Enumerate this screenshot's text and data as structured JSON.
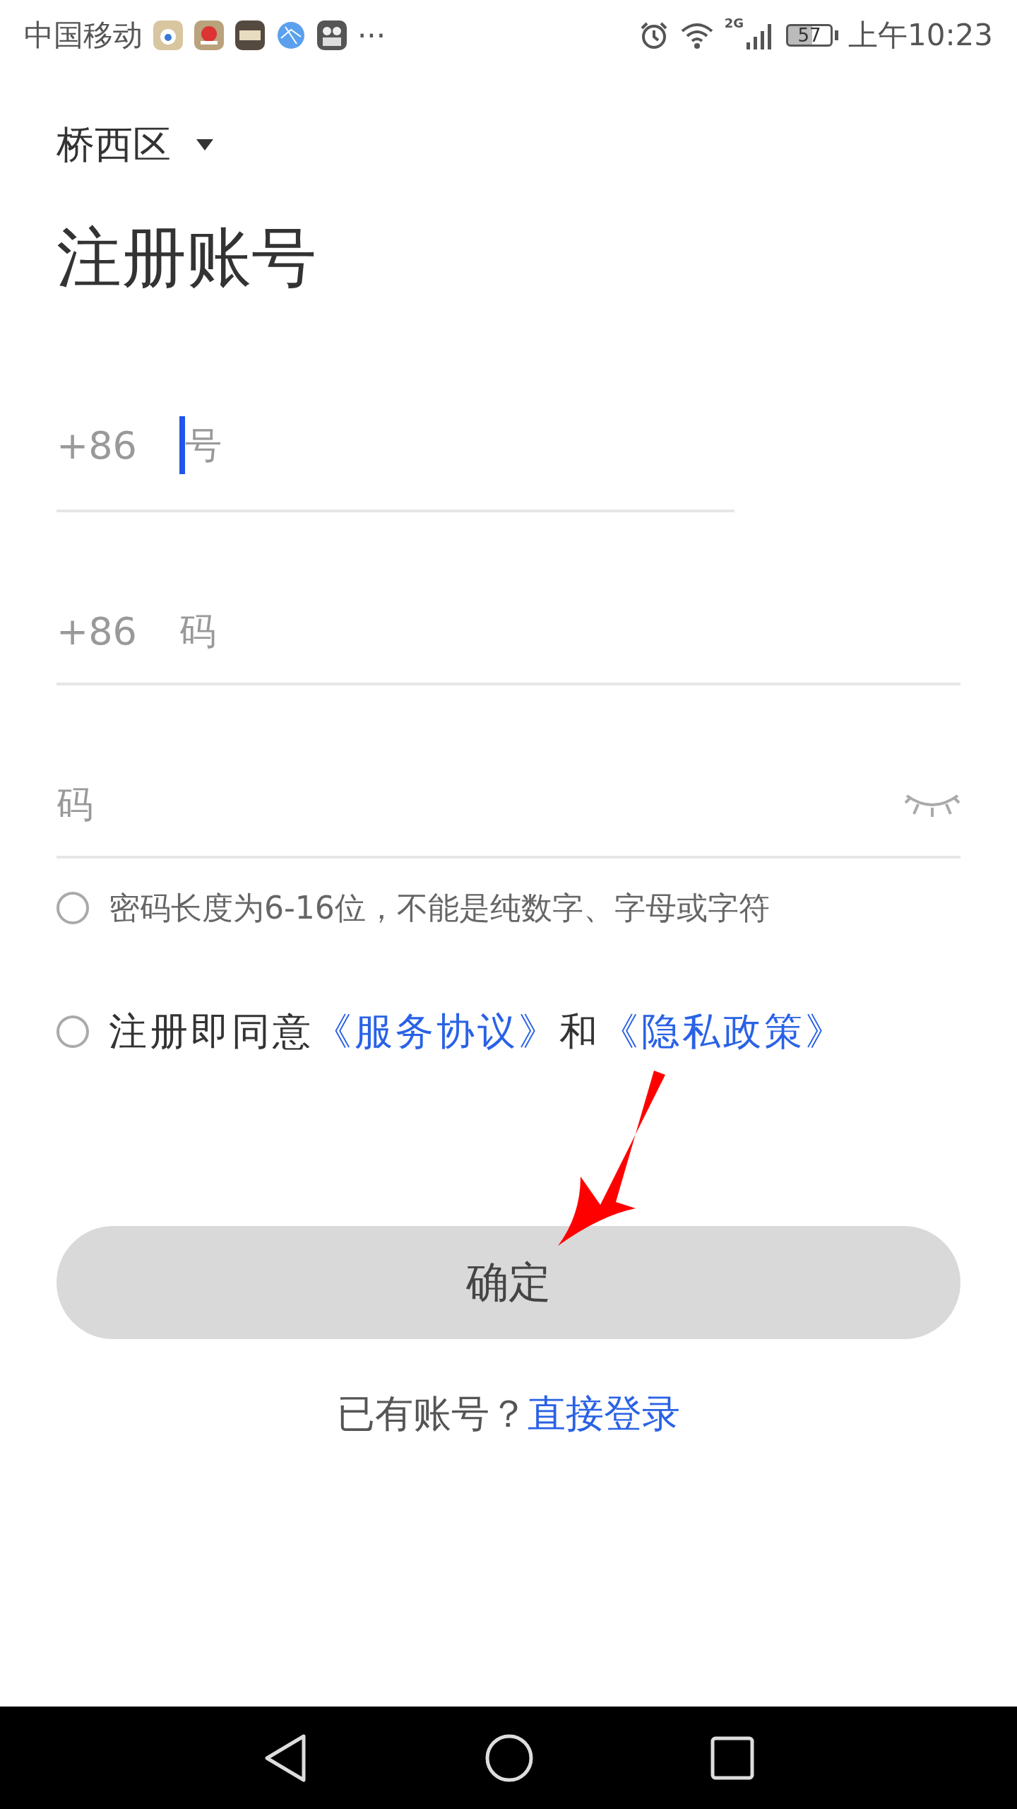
{
  "status_bar": {
    "carrier": "中国移动",
    "more": "···",
    "network": "2G",
    "battery": "57",
    "time": "上午10:23"
  },
  "district": {
    "label": "桥西区"
  },
  "title": "注册账号",
  "fields": [
    {
      "kind": "phone",
      "prefix": "+86",
      "placeholder": "号",
      "focused": true
    },
    {
      "kind": "code",
      "prefix": "+86",
      "placeholder": "码",
      "focused": false
    },
    {
      "kind": "password",
      "placeholder": "码",
      "focused": false
    }
  ],
  "options": [
    {
      "kind": "hint",
      "text": "密码长度为6-16位，不能是纯数字、字母或字符",
      "checked": false
    },
    {
      "kind": "agreement",
      "text": "注册即同意",
      "links": [
        "《服务协议》",
        "《隐私政策》"
      ],
      "joiner": "和",
      "checked": false
    }
  ],
  "confirm_button": "确定",
  "login": {
    "text": "已有账号？",
    "link": "直接登录"
  }
}
